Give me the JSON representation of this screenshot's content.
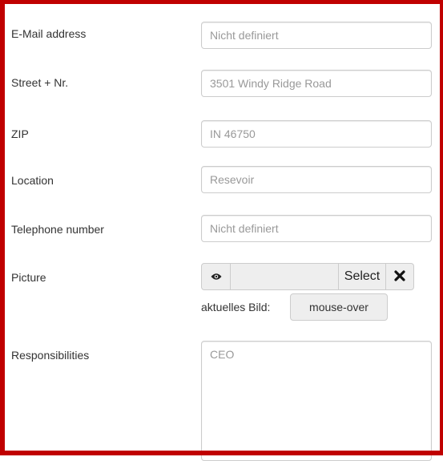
{
  "form": {
    "email": {
      "label": "E-Mail address",
      "placeholder": "Nicht definiert"
    },
    "street": {
      "label": "Street + Nr.",
      "placeholder": "3501 Windy Ridge Road"
    },
    "zip": {
      "label": "ZIP",
      "placeholder": "IN 46750"
    },
    "location": {
      "label": "Location",
      "placeholder": "Resevoir"
    },
    "telephone": {
      "label": "Telephone number",
      "placeholder": "Nicht definiert"
    },
    "picture": {
      "label": "Picture",
      "preview_icon": "eye-icon",
      "select_label": "Select",
      "clear_icon": "close-icon",
      "current_label": "aktuelles Bild:",
      "mouseover_label": "mouse-over"
    },
    "responsibilities": {
      "label": "Responsibilities",
      "placeholder": "CEO"
    }
  },
  "colors": {
    "frame_border": "#c00000",
    "placeholder_text": "#999999",
    "button_bg": "#eeeeee"
  }
}
